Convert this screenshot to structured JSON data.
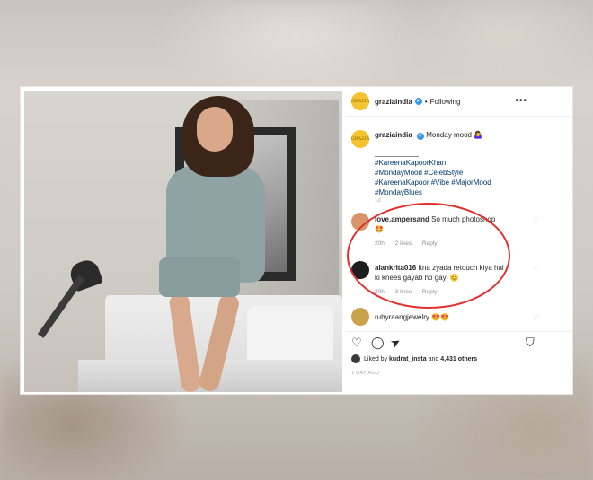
{
  "post": {
    "username": "graziaindia",
    "verified_mark": "✔",
    "dot": "•",
    "follow_status": "Following",
    "more_icon": "•••",
    "avatar_text": "GRAZIA"
  },
  "caption": {
    "username": "graziaindia",
    "text": "Monday mood 🤷‍♀️",
    "line": "___________",
    "hashtags": [
      "#KareenaKapoorKhan",
      "#MondayMood #CelebStyle",
      "#KareenaKapoor #Vibe #MajorMood",
      "#MondayBlues"
    ],
    "timestamp": "1d"
  },
  "comments": [
    {
      "username": "love.ampersand",
      "text": "So much photoshop 🤩",
      "time": "20h",
      "likes": "2 likes",
      "reply": "Reply",
      "avatar_color": "#d9956a"
    },
    {
      "username": "alankrita016",
      "text": "Itna zyada retouch kiya hai ki knees gayab ho gayi 😊",
      "time": "20h",
      "likes": "3 likes",
      "reply": "Reply",
      "avatar_color": "#1e1e1e"
    },
    {
      "username": "rubyraangjewelry",
      "text": "😍😍",
      "avatar_color": "#c9a24b"
    }
  ],
  "footer": {
    "liked_by_prefix": "Liked by",
    "liked_by_user": "kudrat_insta",
    "liked_by_and": "and",
    "liked_by_others": "4,431 others",
    "time_ago": "1 DAY AGO"
  },
  "icons": {
    "heart": "♡",
    "comment": "◯",
    "share": "➤",
    "bookmark": "⛉"
  },
  "colors": {
    "highlight_oval": "#e0302e",
    "link": "#00376b",
    "verified": "#3897f0"
  }
}
